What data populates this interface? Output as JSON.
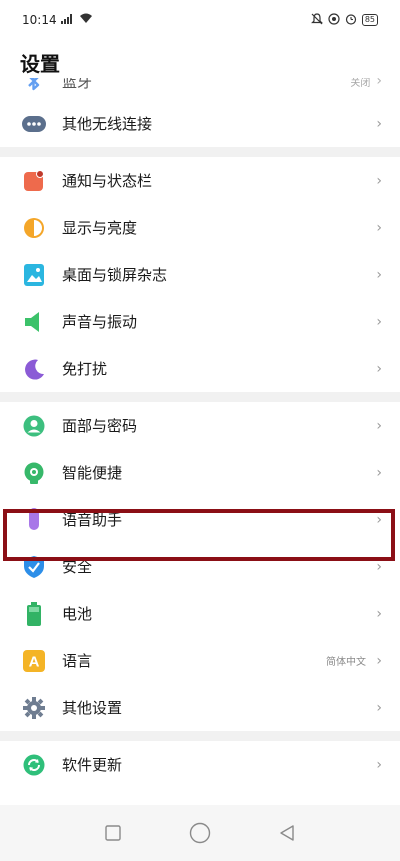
{
  "status_bar": {
    "time": "10:14",
    "network_indicator": "5G",
    "battery": "85"
  },
  "page_title": "设置",
  "items": [
    {
      "id": "bluetooth",
      "label": "蓝牙",
      "value": "关闭",
      "icon": "bluetooth-icon"
    },
    {
      "id": "other-wireless",
      "label": "其他无线连接",
      "icon": "more-wireless-icon"
    },
    {
      "id": "notifications",
      "label": "通知与状态栏",
      "icon": "notification-icon"
    },
    {
      "id": "display",
      "label": "显示与亮度",
      "icon": "display-brightness-icon"
    },
    {
      "id": "wallpaper",
      "label": "桌面与锁屏杂志",
      "icon": "wallpaper-icon"
    },
    {
      "id": "sound",
      "label": "声音与振动",
      "icon": "sound-icon"
    },
    {
      "id": "dnd",
      "label": "免打扰",
      "icon": "moon-icon"
    },
    {
      "id": "face-password",
      "label": "面部与密码",
      "icon": "face-icon"
    },
    {
      "id": "smart-convenience",
      "label": "智能便捷",
      "icon": "smart-icon"
    },
    {
      "id": "voice-assistant",
      "label": "语音助手",
      "icon": "microphone-icon"
    },
    {
      "id": "security",
      "label": "安全",
      "icon": "shield-icon"
    },
    {
      "id": "battery",
      "label": "电池",
      "icon": "battery-icon"
    },
    {
      "id": "language",
      "label": "语言",
      "value": "简体中文",
      "icon": "language-icon"
    },
    {
      "id": "other-settings",
      "label": "其他设置",
      "icon": "gear-icon"
    },
    {
      "id": "software-update",
      "label": "软件更新",
      "icon": "update-icon"
    }
  ],
  "chevron": "›",
  "language_icon_letter": "A"
}
